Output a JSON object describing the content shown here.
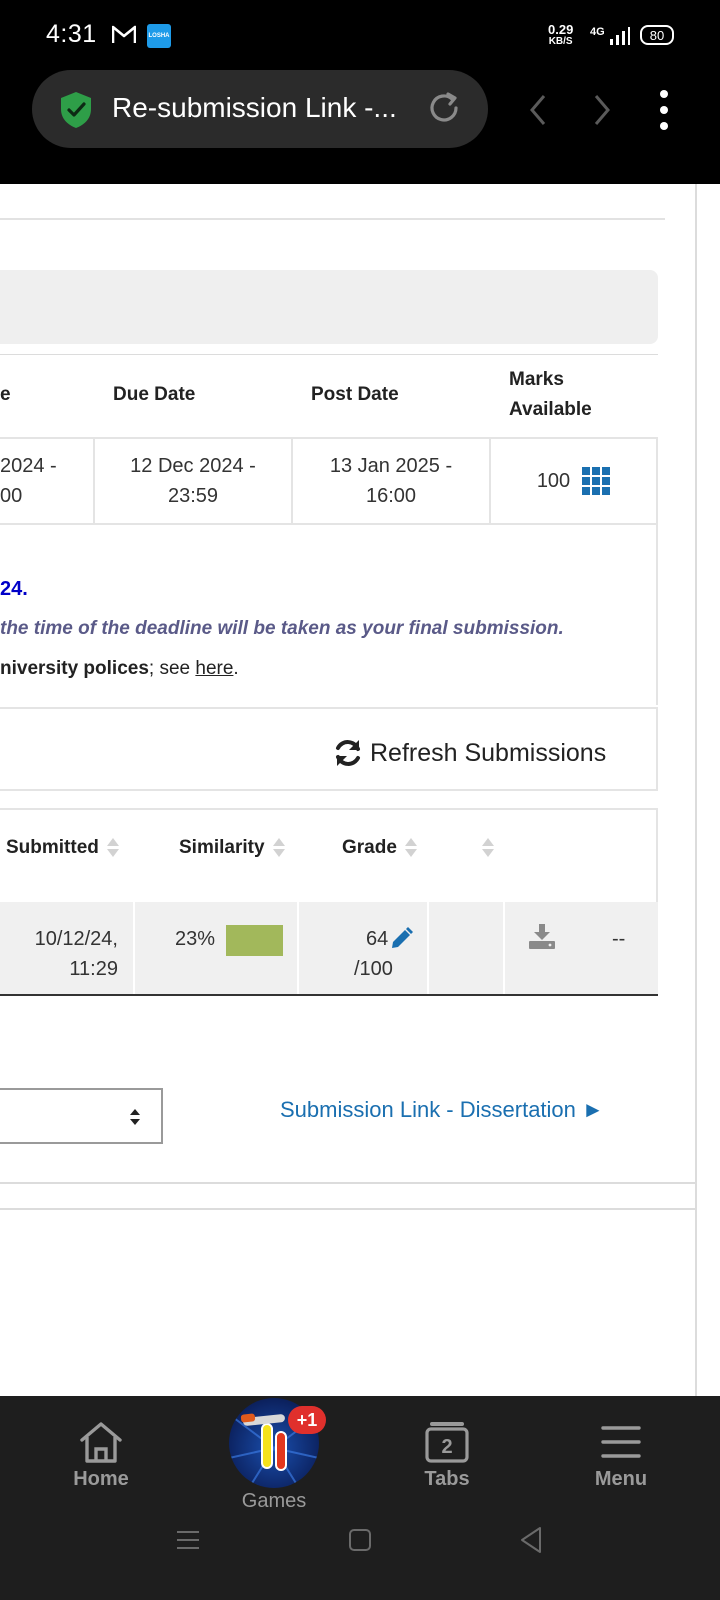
{
  "status_bar": {
    "time": "4:31",
    "speed_value": "0.29",
    "speed_unit": "KB/S",
    "network": "4G",
    "battery": "80",
    "app_badge": "LOSHA"
  },
  "browser": {
    "tab_title": "Re-submission Link -...",
    "security_color": "#2e9e48"
  },
  "assignment_info": {
    "headers": {
      "start_partial": "e",
      "due_date": "Due Date",
      "post_date": "Post Date",
      "marks_available_1": "Marks",
      "marks_available_2": "Available"
    },
    "start_date_line1": "2024 -",
    "start_date_line2": "00",
    "due_date_line1": "12 Dec 2024 -",
    "due_date_line2": "23:59",
    "post_date_line1": "13 Jan 2025 -",
    "post_date_line2": "16:00",
    "marks": "100"
  },
  "notice": {
    "deadline_fragment": "24.",
    "final_submission_note": "the time of the deadline will be taken as your final submission.",
    "policy_bold": "niversity polices",
    "policy_rest": "; see ",
    "policy_link": "here",
    "policy_end": "."
  },
  "refresh_button": "Refresh Submissions",
  "submissions": {
    "headers": {
      "submitted": "Submitted",
      "similarity": "Similarity",
      "grade": "Grade"
    },
    "row": {
      "submitted_line1": "10/12/24,",
      "submitted_line2": "11:29",
      "similarity": "23%",
      "similarity_color": "#a2b85b",
      "grade_score": "64",
      "grade_total": "/100",
      "extra": "--"
    }
  },
  "next_link": "Submission Link - Dissertation ►",
  "bottom_nav": {
    "home": "Home",
    "games": "Games",
    "games_badge": "+1",
    "tabs": "Tabs",
    "tabs_count": "2",
    "menu": "Menu"
  }
}
